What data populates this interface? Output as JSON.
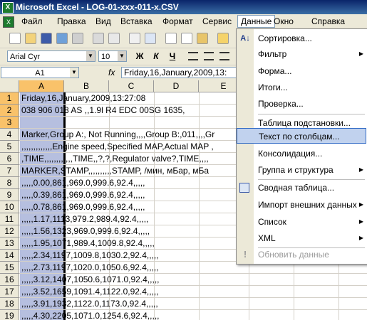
{
  "window": {
    "title": "Microsoft Excel - LOG-01-xxx-011-x.CSV",
    "app_icon": "excel-icon"
  },
  "menubar": {
    "items": [
      {
        "label": "Файл"
      },
      {
        "label": "Правка"
      },
      {
        "label": "Вид"
      },
      {
        "label": "Вставка"
      },
      {
        "label": "Формат"
      },
      {
        "label": "Сервис"
      },
      {
        "label": "Данные"
      },
      {
        "label": "Окно"
      },
      {
        "label": "Справка"
      }
    ],
    "active_index": 6
  },
  "format_toolbar": {
    "font": "Arial Cyr",
    "size": "10",
    "bold": "Ж",
    "italic": "К",
    "underline": "Ч"
  },
  "formula_bar": {
    "name_box": "A1",
    "fx": "fx",
    "value": "Friday,16,January,2009,13:"
  },
  "grid": {
    "columns": [
      "A",
      "B",
      "C",
      "D",
      "E"
    ],
    "rows": [
      "1",
      "2",
      "3",
      "4",
      "5",
      "6",
      "7",
      "8",
      "9",
      "10",
      "11",
      "12",
      "13",
      "14",
      "15",
      "16",
      "17",
      "18",
      "19"
    ],
    "cells": [
      "Friday,16,January,2009,13:27:08",
      "038 906 018 AS ,,1.9l R4 EDC   00SG  1635,",
      "",
      "Marker,Group A:, Not Running,,,,Group B:,011,,,,Gr",
      ",,,,,,,,,,,,,Engine speed,Specified MAP,Actual MAP ,",
      ",TIME,,,,,,,,,,,,TIME,,?,?,Regulator valve?,TIME,,,,",
      "MARKER,STAMP,,,,,,,,,,STAMP, /мин, мБар, мБа",
      ",,,,,0.00,861,969.0,999.6,92.4,,,,,",
      ",,,,,0.39,861,969.0,999.6,92.4,,,,,",
      ",,,,,0.78,861,969.0,999.6,92.4,,,,,",
      ",,,,,1.17,1113,979.2,989.4,92.4,,,,,",
      ",,,,,1.56,1323,969.0,999.6,92.4,,,,,",
      ",,,,,1.95,1071,989.4,1009.8,92.4,,,,,",
      ",,,,,2.34,1197,1009.8,1030.2,92.4,,,,,",
      ",,,,,2.73,1197,1020.0,1050.6,92.4,,,,,",
      ",,,,,3.12,1407,1050.6,1071.0,92.4,,,,,",
      ",,,,,3.52,1659,1091.4,1122.0,92.4,,,,,",
      ",,,,,3.91,1932,1122.0,1173.0,92.4,,,,,",
      ",,,,,4.30,2205,1071.0,1254.6,92.4,,,,,"
    ]
  },
  "dropdown": {
    "items": [
      {
        "label": "Сортировка...",
        "icon": "sort-az-icon"
      },
      {
        "label": "Фильтр",
        "submenu": true
      },
      {
        "label": "Форма..."
      },
      {
        "label": "Итоги..."
      },
      {
        "label": "Проверка..."
      },
      {
        "label": "Таблица подстановки..."
      },
      {
        "label": "Текст по столбцам...",
        "highlighted": true
      },
      {
        "label": "Консолидация..."
      },
      {
        "label": "Группа и структура",
        "submenu": true
      },
      {
        "label": "Сводная таблица...",
        "icon": "pivot-table-icon"
      },
      {
        "label": "Импорт внешних данных",
        "submenu": true
      },
      {
        "label": "Список",
        "submenu": true
      },
      {
        "label": "XML",
        "submenu": true
      },
      {
        "label": "Обновить данные",
        "icon": "exclamation-icon",
        "disabled": true
      }
    ]
  },
  "colors": {
    "title_bar": "#0A246A",
    "selection": "#B6BFDF",
    "highlight": "#C1D2EE",
    "header_selected": "#F9C26A"
  }
}
